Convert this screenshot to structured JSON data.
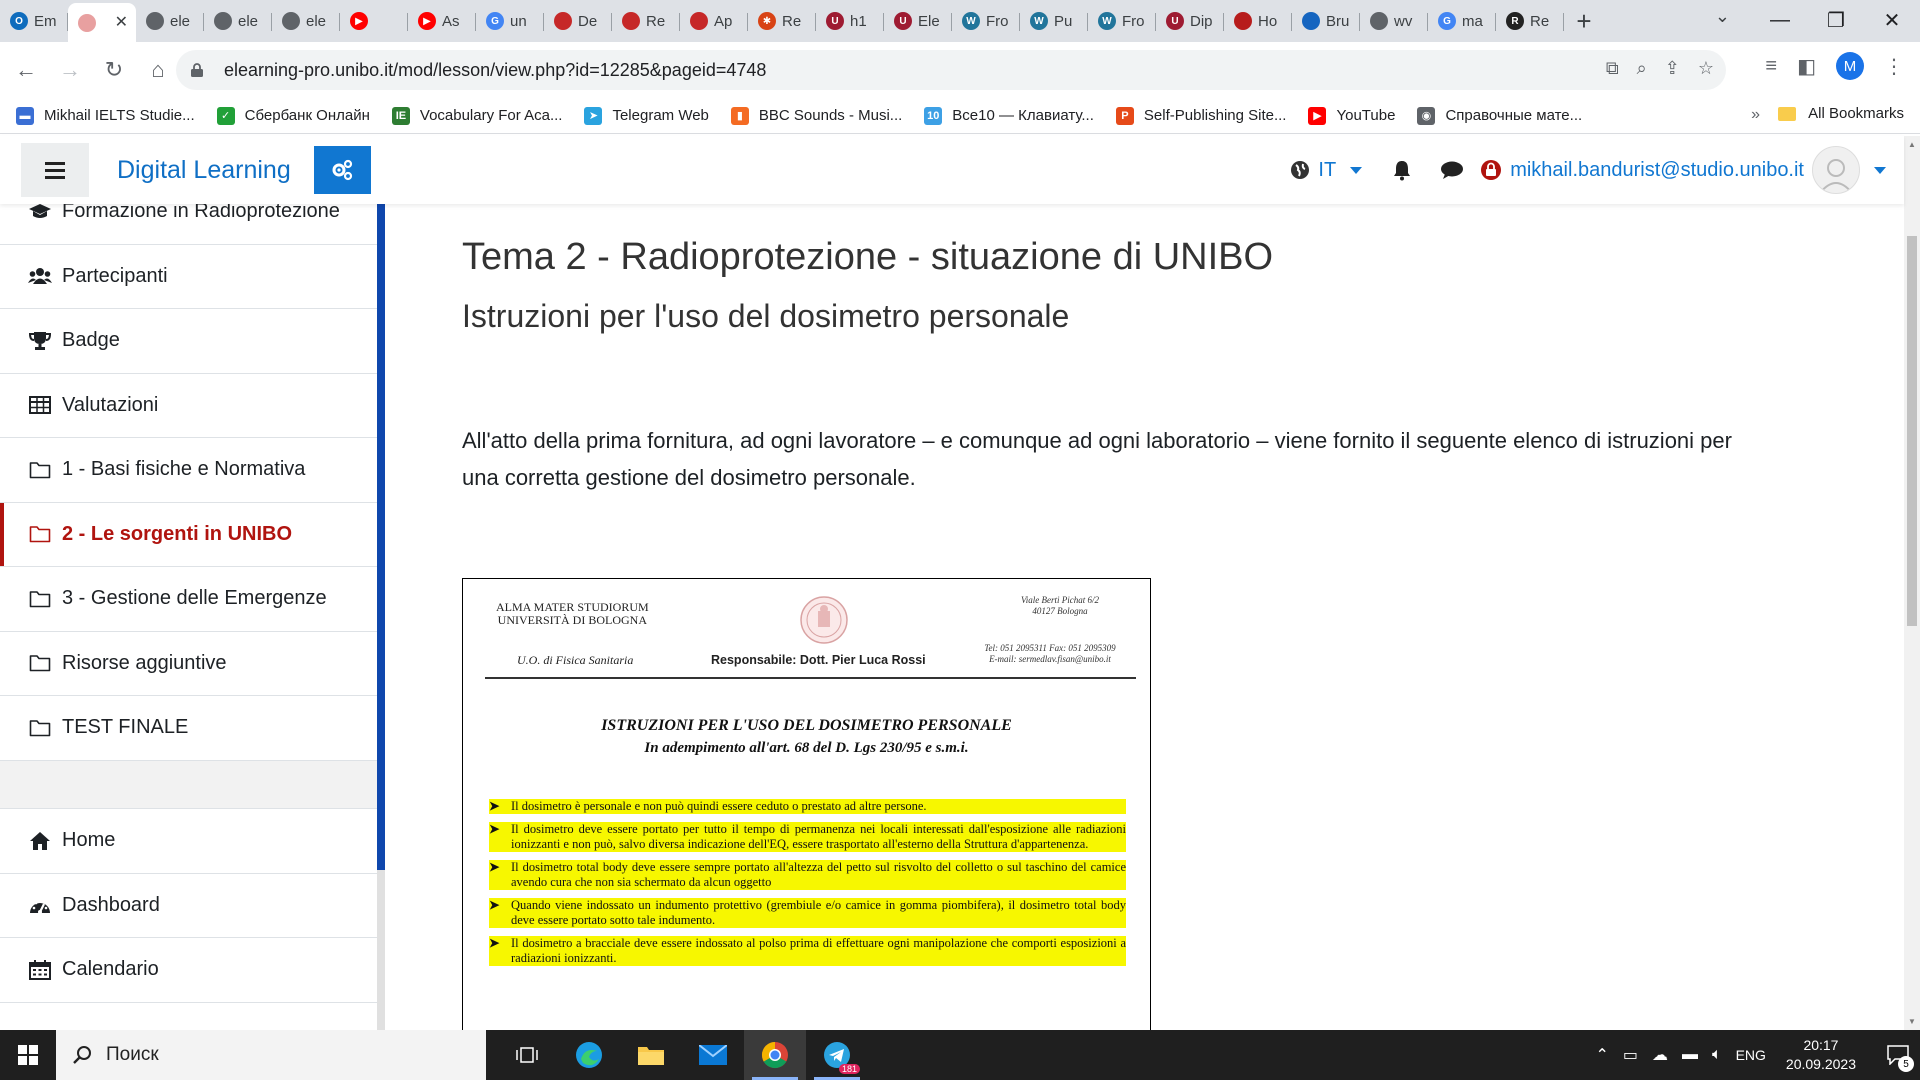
{
  "browser": {
    "tabs": [
      {
        "label": "Em",
        "color": "#0f6cbd",
        "glyph": "O"
      },
      {
        "label": "",
        "color": "#e8a0a0",
        "glyph": "",
        "active": true
      },
      {
        "label": "ele",
        "color": "#5f6368",
        "glyph": ""
      },
      {
        "label": "ele",
        "color": "#5f6368",
        "glyph": ""
      },
      {
        "label": "ele",
        "color": "#5f6368",
        "glyph": ""
      },
      {
        "label": "",
        "color": "#ff0000",
        "glyph": "▶"
      },
      {
        "label": "As",
        "color": "#ff0000",
        "glyph": "▶"
      },
      {
        "label": "un",
        "color": "#4285f4",
        "glyph": "G"
      },
      {
        "label": "De",
        "color": "#c62828",
        "glyph": ""
      },
      {
        "label": "Re",
        "color": "#c62828",
        "glyph": ""
      },
      {
        "label": "Ap",
        "color": "#c62828",
        "glyph": ""
      },
      {
        "label": "Re",
        "color": "#d84315",
        "glyph": "✱"
      },
      {
        "label": "h1",
        "color": "#9e1b32",
        "glyph": "U"
      },
      {
        "label": "Ele",
        "color": "#9e1b32",
        "glyph": "U"
      },
      {
        "label": "Fro",
        "color": "#21759b",
        "glyph": "W"
      },
      {
        "label": "Pu",
        "color": "#21759b",
        "glyph": "W"
      },
      {
        "label": "Fro",
        "color": "#21759b",
        "glyph": "W"
      },
      {
        "label": "Dip",
        "color": "#9e1b32",
        "glyph": "U"
      },
      {
        "label": "Ho",
        "color": "#b71c1c",
        "glyph": ""
      },
      {
        "label": "Bru",
        "color": "#1565c0",
        "glyph": ""
      },
      {
        "label": "wv",
        "color": "#5f6368",
        "glyph": ""
      },
      {
        "label": "ma",
        "color": "#4285f4",
        "glyph": "G"
      },
      {
        "label": "Re",
        "color": "#222222",
        "glyph": "R"
      }
    ],
    "url": "elearning-pro.unibo.it/mod/lesson/view.php?id=12285&pageid=4748",
    "profile_initial": "M",
    "bookmarks": [
      {
        "label": "Mikhail IELTS Studie...",
        "color": "#3b6fd4",
        "glyph": "▬"
      },
      {
        "label": "Сбербанк Онлайн",
        "color": "#21a038",
        "glyph": "✓"
      },
      {
        "label": "Vocabulary For Aca...",
        "color": "#2e7d32",
        "glyph": "IE"
      },
      {
        "label": "Telegram Web",
        "color": "#2aa3df",
        "glyph": "➤"
      },
      {
        "label": "BBC Sounds - Musi...",
        "color": "#f46b23",
        "glyph": "▮"
      },
      {
        "label": "Все10 — Клавиату...",
        "color": "#3da0e5",
        "glyph": "10"
      },
      {
        "label": "Self-Publishing Site...",
        "color": "#e64a19",
        "glyph": "P"
      },
      {
        "label": "YouTube",
        "color": "#ff0000",
        "glyph": "▶"
      },
      {
        "label": "Справочные мате...",
        "color": "#5f6368",
        "glyph": "◉"
      }
    ],
    "bookmarks_more": "»",
    "all_bookmarks": "All Bookmarks"
  },
  "navbar": {
    "site_name": "Digital Learning",
    "lang": "IT",
    "user_email": "mikhail.bandurist@studio.unibo.it"
  },
  "drawer": {
    "course_items": [
      {
        "label": "Formazione in Radioprotezione",
        "icon": "graduation-cap-icon"
      },
      {
        "label": "Partecipanti",
        "icon": "users-icon"
      },
      {
        "label": "Badge",
        "icon": "trophy-icon"
      },
      {
        "label": "Valutazioni",
        "icon": "table-icon"
      },
      {
        "label": "1 - Basi fisiche e Normativa",
        "icon": "folder-icon"
      },
      {
        "label": "2 - Le sorgenti in UNIBO",
        "icon": "folder-icon",
        "active": true
      },
      {
        "label": "3 - Gestione delle Emergenze",
        "icon": "folder-icon"
      },
      {
        "label": "Risorse aggiuntive",
        "icon": "folder-icon"
      },
      {
        "label": "TEST FINALE",
        "icon": "folder-icon"
      }
    ],
    "site_items": [
      {
        "label": "Home",
        "icon": "home-icon"
      },
      {
        "label": "Dashboard",
        "icon": "dashboard-icon"
      },
      {
        "label": "Calendario",
        "icon": "calendar-icon"
      }
    ]
  },
  "main": {
    "title": "Tema 2 - Radioprotezione - situazione di UNIBO",
    "subtitle": "Istruzioni per l'uso del dosimetro personale",
    "intro": "All'atto della prima fornitura, ad ogni lavoratore – e comunque ad ogni laboratorio – viene fornito il seguente elenco di istruzioni per una corretta gestione del dosimetro personale."
  },
  "document": {
    "org_line1": "ALMA MATER STUDIORUM",
    "org_line2": "UNIVERSITÀ DI BOLOGNA",
    "unit": "U.O. di Fisica Sanitaria",
    "responsible": "Responsabile: Dott. Pier Luca Rossi",
    "address_line1": "Viale Berti Pichat 6/2",
    "address_line2": "40127 Bologna",
    "contact_line1": "Tel: 051 2095311 Fax: 051 2095309",
    "contact_line2": "E-mail: sermedlav.fisan@unibo.it",
    "title": "ISTRUZIONI PER L'USO DEL DOSIMETRO PERSONALE",
    "title2": "In adempimento all'art. 68 del D. Lgs 230/95 e s.m.i.",
    "items": [
      "Il dosimetro è personale e non può quindi essere ceduto o prestato ad altre persone.",
      "Il dosimetro deve essere portato per tutto il tempo di permanenza nei locali interessati dall'esposizione alle radiazioni ionizzanti e non può, salvo diversa indicazione dell'EQ, essere trasportato all'esterno della Struttura d'appartenenza.",
      "Il dosimetro total body deve essere sempre portato all'altezza del petto sul risvolto del colletto o sul taschino del camice avendo cura che non sia schermato da alcun oggetto",
      "Quando viene indossato un indumento protettivo (grembiule e/o camice in gomma piombifera), il dosimetro total body deve essere portato sotto tale indumento.",
      "Il dosimetro a bracciale deve essere indossato al polso prima di effettuare ogni manipolazione che comporti esposizioni a radiazioni ionizzanti."
    ]
  },
  "taskbar": {
    "search_placeholder": "Поиск",
    "language": "ENG",
    "time": "20:17",
    "date": "20.09.2023",
    "telegram_badge": "181",
    "notifications": "5"
  }
}
